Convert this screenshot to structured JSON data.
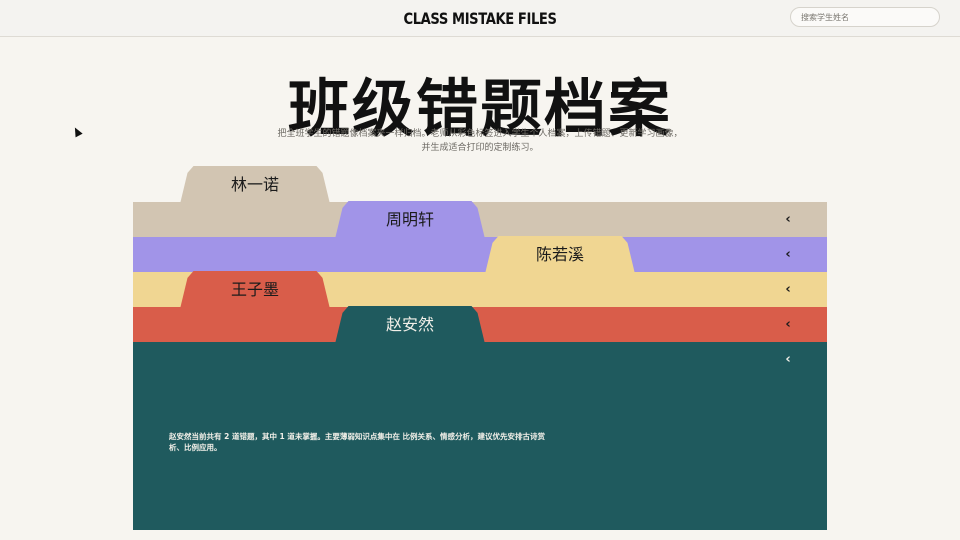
{
  "header": {
    "brand": "CLASS MISTAKE FILES",
    "search_placeholder": "搜索学生姓名"
  },
  "hero": {
    "title": "班级错题档案",
    "subtitle_line1": "把全班学生的错题像档案夹一样归档。老师从彩色标签进入学生个人档案，上传错题、更新学习画像，",
    "subtitle_line2": "并生成适合打印的定制练习。"
  },
  "folders": [
    {
      "name": "林一诺",
      "color": "#d2c5b2"
    },
    {
      "name": "周明轩",
      "color": "#a194e8"
    },
    {
      "name": "陈若溪",
      "color": "#f0d692"
    },
    {
      "name": "王子墨",
      "color": "#d95d4a"
    },
    {
      "name": "赵安然",
      "color": "#1f5a5e"
    }
  ],
  "active_folder": {
    "name": "赵安然",
    "summary": "赵安然当前共有 2 道错题，其中 1 道未掌握。主要薄弱知识点集中在 比例关系、情感分析，建议优先安排古诗赏析、比例应用。"
  },
  "icons": {
    "folder_toggle": "chevron-left-icon",
    "pointer": "mouse-cursor-icon"
  }
}
